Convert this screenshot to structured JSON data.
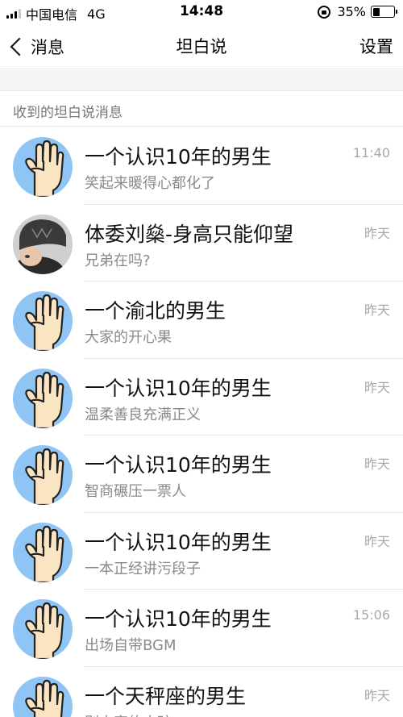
{
  "status_bar": {
    "carrier": "中国电信",
    "network": "4G",
    "time": "14:48",
    "battery": "35%",
    "battery_level": 0.35
  },
  "nav": {
    "back_label": "消息",
    "title": "坦白说",
    "settings_label": "设置"
  },
  "section": {
    "header": "收到的坦白说消息"
  },
  "messages": [
    {
      "title": "一个认识10年的男生",
      "subtitle": "笑起来暖得心都化了",
      "time": "11:40",
      "avatar": "hand-icon"
    },
    {
      "title": "体委刘燊-身高只能仰望",
      "subtitle": "兄弟在吗?",
      "time": "昨天",
      "avatar": "photo"
    },
    {
      "title": "一个渝北的男生",
      "subtitle": "大家的开心果",
      "time": "昨天",
      "avatar": "hand-icon"
    },
    {
      "title": "一个认识10年的男生",
      "subtitle": "温柔善良充满正义",
      "time": "昨天",
      "avatar": "hand-icon"
    },
    {
      "title": "一个认识10年的男生",
      "subtitle": "智商碾压一票人",
      "time": "昨天",
      "avatar": "hand-icon"
    },
    {
      "title": "一个认识10年的男生",
      "subtitle": "一本正经讲污段子",
      "time": "昨天",
      "avatar": "hand-icon"
    },
    {
      "title": "一个认识10年的男生",
      "subtitle": "出场自带BGM",
      "time": "15:06",
      "avatar": "hand-icon"
    },
    {
      "title": "一个天秤座的男生",
      "subtitle": "别人家的小孩",
      "time": "昨天",
      "avatar": "hand-icon"
    }
  ],
  "colors": {
    "avatar_bg": "#8ec5f5",
    "hand_fill": "#fbe4c2",
    "hand_stroke": "#222222"
  }
}
